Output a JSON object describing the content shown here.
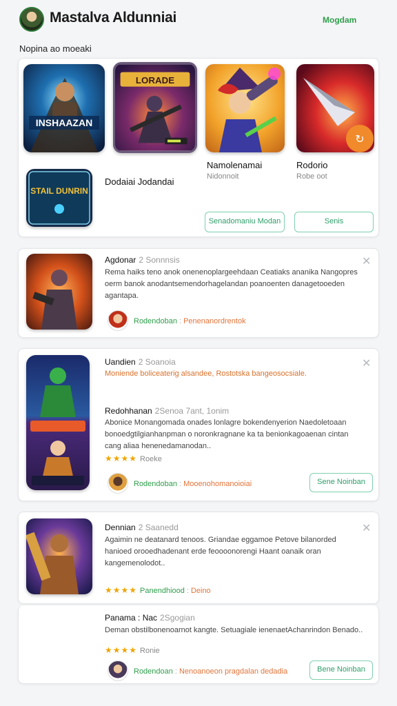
{
  "header": {
    "title": "Mastalva Aldunniai",
    "link": "Mogdam",
    "section": "Nopina ao moeaki"
  },
  "featured": {
    "tiles": [
      {
        "caption": "INSHAAZAN"
      },
      {
        "caption": "LORADE"
      },
      {
        "caption": ""
      },
      {
        "caption": ""
      }
    ],
    "game1_name": "Namolenamai",
    "game1_sub": "Nidonnoit",
    "game2_name": "Rodorio",
    "game2_sub": "Robe oot",
    "small_tile_caption": "STAIL DUNRIN",
    "left_label": "Dodaiai Jodandai",
    "btn1": "Senadomaniu Modan",
    "btn2": "Senis"
  },
  "reviews": [
    {
      "title": "Agdonar",
      "meta": "2 Sonnnsis",
      "body": "Rema haiks teno anok onenenoplargeehdaan Ceatiaks ananika Nangopres oerm banok anodantsemendorhagelandan poanoenten danagetooeden agantapa.",
      "author": "Rodendoban",
      "tag": "Penenanordrentok"
    },
    {
      "title": "Uandien",
      "meta": "2 Soanoia",
      "body": "Moniende boliceaterig alsandee, Rostotska bangeosocsiale.",
      "sub_title": "Redohhanan",
      "sub_meta": "2Senoa 7ant, 1onim",
      "sub_body": "Abonice Monangomada onades lonlagre bokendenyerion Naedoletoaan bonoedgtilgianhanpman o noronkragnane ka ta benionkagoaenan cintan cang aliaa henenedamanodan..",
      "stars": "★★★★",
      "star_label": "Roeke",
      "author": "Rodendoban",
      "tag": "Mooenohomanoioiai",
      "button": "Sene Noinban"
    },
    {
      "title": "Dennian",
      "meta": "2 Saanedd",
      "body": "Agaimin ne deatanard tenoos. Griandae eggamoe Petove bilanorded hanioed orooedhadenant erde feoooonorengi Haant oanaik oran kangemenolodot..",
      "stars": "★★★★",
      "star_label": "Panendhiood",
      "star_extra": "Deino"
    },
    {
      "title": "Panama : Nac",
      "meta": "2Sgogian",
      "body": "Deman obstilbonenoarnot kangte. Setuagiale ienenaetAchanrindon Benado..",
      "stars": "★★★★",
      "star_label": "Ronie",
      "author": "Rodendoan",
      "tag": "Nenoanoeon pragdalan dedadia",
      "button": "Bene Noinban"
    }
  ],
  "colors": {
    "accent": "#2e9e4a",
    "orange": "#e2743a",
    "star": "#f0a500"
  }
}
